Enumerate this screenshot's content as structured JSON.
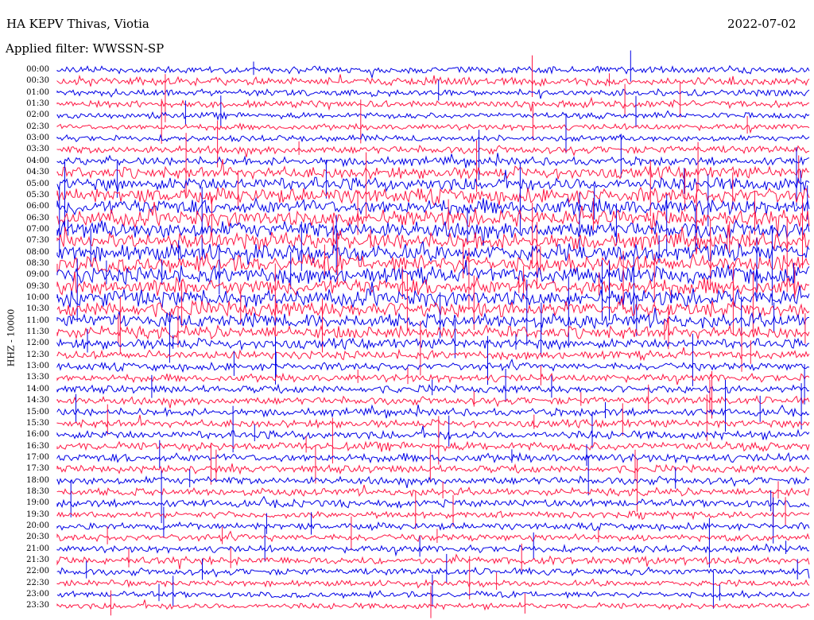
{
  "header": {
    "station": "HA KEPV Thivas, Viotia",
    "date": "2022-07-02",
    "filter": "Applied filter: WWSSN-SP"
  },
  "axis": {
    "channel_label": "HHZ - 10000"
  },
  "colors": {
    "trace_a": "#0000e6",
    "trace_b": "#ff1744",
    "background": "#ffffff",
    "text": "#000000"
  },
  "chart_data": {
    "type": "line",
    "title": "HA KEPV Thivas, Viotia",
    "ylabel": "HHZ - 10000",
    "series": [
      {
        "name": "00:00",
        "color": "#0000e6",
        "activity": 0.25
      },
      {
        "name": "00:30",
        "color": "#ff1744",
        "activity": 0.3
      },
      {
        "name": "01:00",
        "color": "#0000e6",
        "activity": 0.25
      },
      {
        "name": "01:30",
        "color": "#ff1744",
        "activity": 0.25
      },
      {
        "name": "02:00",
        "color": "#0000e6",
        "activity": 0.2
      },
      {
        "name": "02:30",
        "color": "#ff1744",
        "activity": 0.2
      },
      {
        "name": "03:00",
        "color": "#0000e6",
        "activity": 0.2
      },
      {
        "name": "03:30",
        "color": "#ff1744",
        "activity": 0.3
      },
      {
        "name": "04:00",
        "color": "#0000e6",
        "activity": 0.35
      },
      {
        "name": "04:30",
        "color": "#ff1744",
        "activity": 0.55
      },
      {
        "name": "05:00",
        "color": "#0000e6",
        "activity": 0.65
      },
      {
        "name": "05:30",
        "color": "#ff1744",
        "activity": 0.75
      },
      {
        "name": "06:00",
        "color": "#0000e6",
        "activity": 0.8
      },
      {
        "name": "06:30",
        "color": "#ff1744",
        "activity": 0.85
      },
      {
        "name": "07:00",
        "color": "#0000e6",
        "activity": 0.85
      },
      {
        "name": "07:30",
        "color": "#ff1744",
        "activity": 0.85
      },
      {
        "name": "08:00",
        "color": "#0000e6",
        "activity": 0.85
      },
      {
        "name": "08:30",
        "color": "#ff1744",
        "activity": 0.85
      },
      {
        "name": "09:00",
        "color": "#0000e6",
        "activity": 0.85
      },
      {
        "name": "09:30",
        "color": "#ff1744",
        "activity": 0.85
      },
      {
        "name": "10:00",
        "color": "#0000e6",
        "activity": 0.85
      },
      {
        "name": "10:30",
        "color": "#ff1744",
        "activity": 0.8
      },
      {
        "name": "11:00",
        "color": "#0000e6",
        "activity": 0.7
      },
      {
        "name": "11:30",
        "color": "#ff1744",
        "activity": 0.6
      },
      {
        "name": "12:00",
        "color": "#0000e6",
        "activity": 0.45
      },
      {
        "name": "12:30",
        "color": "#ff1744",
        "activity": 0.35
      },
      {
        "name": "13:00",
        "color": "#0000e6",
        "activity": 0.3
      },
      {
        "name": "13:30",
        "color": "#ff1744",
        "activity": 0.3
      },
      {
        "name": "14:00",
        "color": "#0000e6",
        "activity": 0.3
      },
      {
        "name": "14:30",
        "color": "#ff1744",
        "activity": 0.3
      },
      {
        "name": "15:00",
        "color": "#0000e6",
        "activity": 0.3
      },
      {
        "name": "15:30",
        "color": "#ff1744",
        "activity": 0.3
      },
      {
        "name": "16:00",
        "color": "#0000e6",
        "activity": 0.35
      },
      {
        "name": "16:30",
        "color": "#ff1744",
        "activity": 0.35
      },
      {
        "name": "17:00",
        "color": "#0000e6",
        "activity": 0.35
      },
      {
        "name": "17:30",
        "color": "#ff1744",
        "activity": 0.3
      },
      {
        "name": "18:00",
        "color": "#0000e6",
        "activity": 0.3
      },
      {
        "name": "18:30",
        "color": "#ff1744",
        "activity": 0.3
      },
      {
        "name": "19:00",
        "color": "#0000e6",
        "activity": 0.3
      },
      {
        "name": "19:30",
        "color": "#ff1744",
        "activity": 0.25
      },
      {
        "name": "20:00",
        "color": "#0000e6",
        "activity": 0.25
      },
      {
        "name": "20:30",
        "color": "#ff1744",
        "activity": 0.25
      },
      {
        "name": "21:00",
        "color": "#0000e6",
        "activity": 0.25
      },
      {
        "name": "21:30",
        "color": "#ff1744",
        "activity": 0.3
      },
      {
        "name": "22:00",
        "color": "#0000e6",
        "activity": 0.25
      },
      {
        "name": "22:30",
        "color": "#ff1744",
        "activity": 0.2
      },
      {
        "name": "23:00",
        "color": "#0000e6",
        "activity": 0.2
      },
      {
        "name": "23:30",
        "color": "#ff1744",
        "activity": 0.2
      }
    ]
  }
}
